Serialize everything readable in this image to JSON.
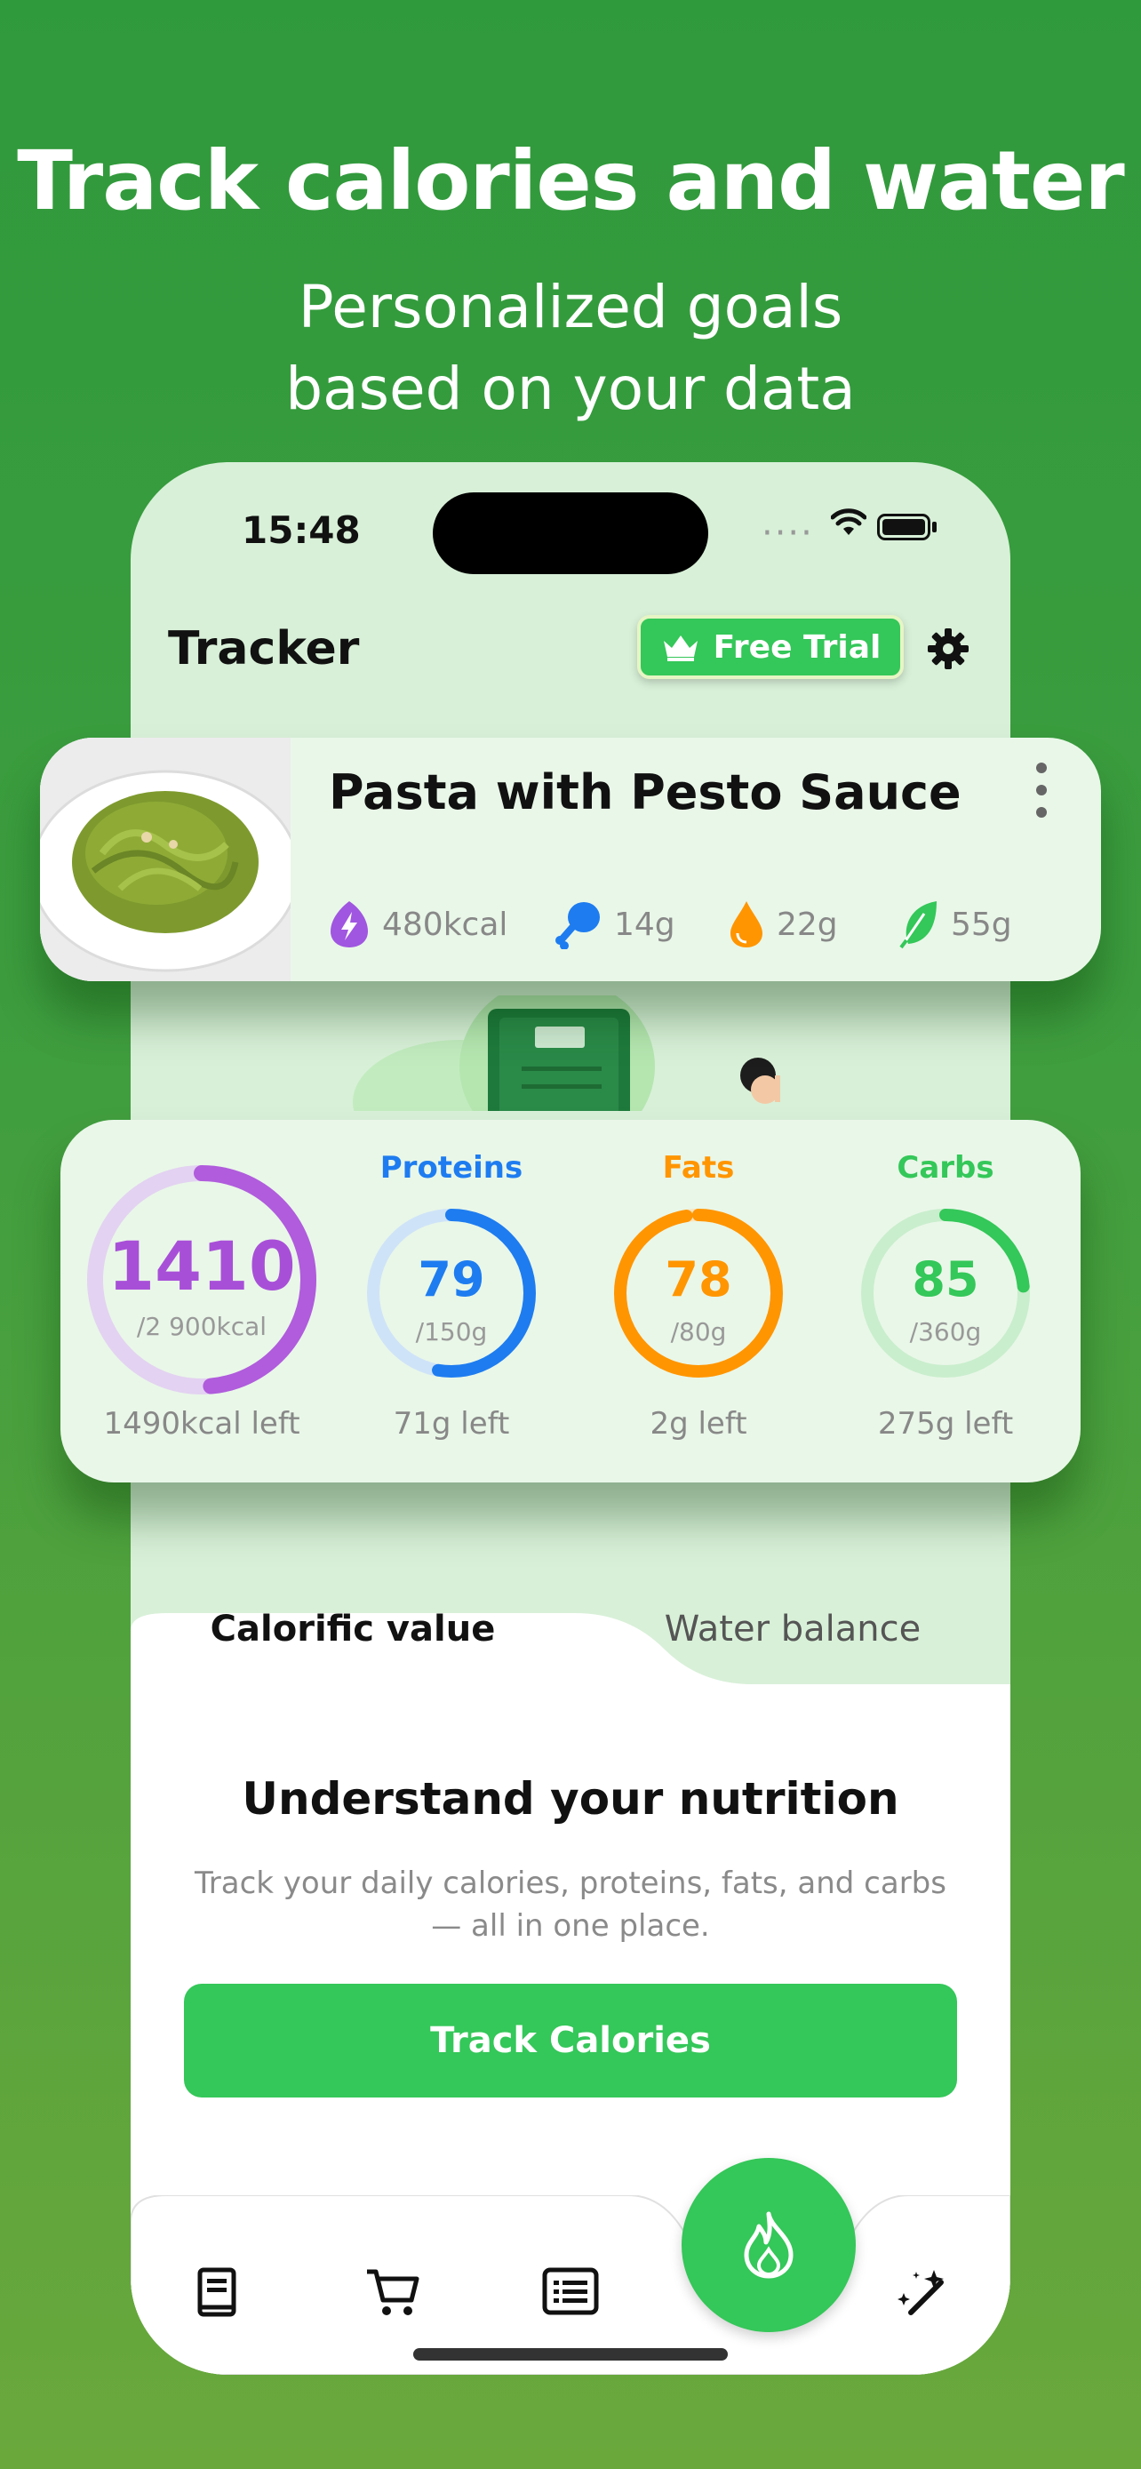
{
  "headline": "Track calories and water",
  "subline": [
    "Personalized goals",
    "based on your data"
  ],
  "status_bar": {
    "time": "15:48"
  },
  "header": {
    "title": "Tracker",
    "free_trial": "Free Trial"
  },
  "meal": {
    "name": "Pasta with Pesto Sauce",
    "kcal": "480kcal",
    "protein": "14g",
    "fat": "22g",
    "carbs": "55g"
  },
  "summary": {
    "calories": {
      "value": "1410",
      "goal": "/2 900kcal",
      "left": "1490kcal left",
      "progress": 0.486,
      "color": "#b05cdc"
    },
    "proteins": {
      "label": "Proteins",
      "value": "79",
      "goal": "/150g",
      "left": "71g left",
      "progress": 0.527,
      "color": "#1e7cf0"
    },
    "fats": {
      "label": "Fats",
      "value": "78",
      "goal": "/80g",
      "left": "2g left",
      "progress": 0.975,
      "color": "#ff9500"
    },
    "carbs": {
      "label": "Carbs",
      "value": "85",
      "goal": "/360g",
      "left": "275g left",
      "progress": 0.236,
      "color": "#34c759"
    }
  },
  "tabs": {
    "active": "Calorific value",
    "inactive": "Water balance"
  },
  "content": {
    "title": "Understand your nutrition",
    "description_line1": "Track your daily calories, proteins, fats, and carbs",
    "description_line2": "— all in one place.",
    "button": "Track Calories"
  },
  "nav": {
    "icons": [
      "book-icon",
      "cart-icon",
      "list-icon",
      "flame-icon",
      "magic-wand-icon"
    ]
  }
}
